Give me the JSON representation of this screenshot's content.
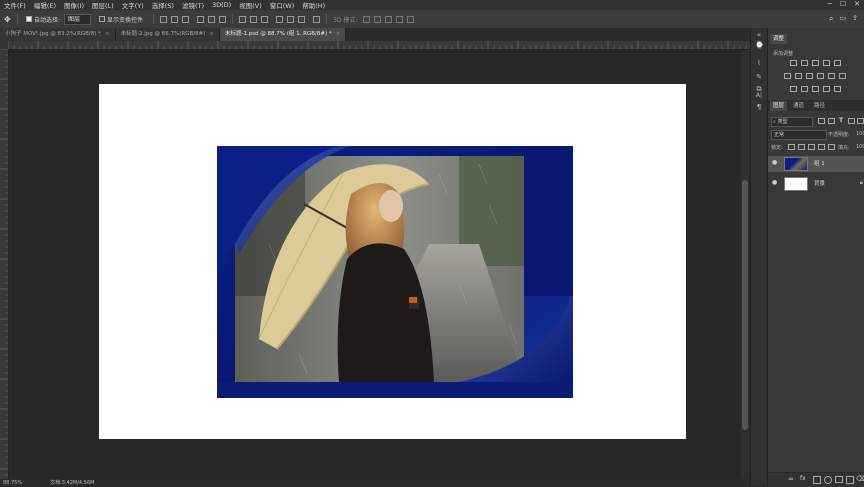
{
  "menu": [
    "文件(F)",
    "编辑(E)",
    "图像(I)",
    "图层(L)",
    "文字(Y)",
    "选择(S)",
    "滤镜(T)",
    "3D(D)",
    "视图(V)",
    "窗口(W)",
    "帮助(H)"
  ],
  "options": {
    "auto_select_label": "自动选择:",
    "auto_select_value": "图层",
    "transform_label": "显示变换控件",
    "mode_3d_label": "3D 模式:"
  },
  "tabs": [
    {
      "label": "小狗子 MOV!.jpg @ 83.2%(RGB/8) *",
      "active": false
    },
    {
      "label": "未标题-2.jpg @ 66.7%(RGB/8#)",
      "active": false
    },
    {
      "label": "未标题-1.psd @ 88.7% (组 1, RGB/8#) *",
      "active": true
    }
  ],
  "status": {
    "zoom": "88.75%",
    "doc": "文档:3.42M/4.56M"
  },
  "panels": {
    "adjust_tab": "调整",
    "add_adjust_label": "添加调整",
    "layers_tab": "图层",
    "channels_tab": "通道",
    "paths_tab": "路径",
    "kind_filter": "类型",
    "blend_mode": "正常",
    "opacity_label": "不透明度:",
    "opacity_value": "100",
    "lock_label": "锁定:",
    "fill_label": "填充:",
    "fill_value": "100",
    "layers": [
      {
        "name": "组 1",
        "selected": true
      },
      {
        "name": "背景",
        "selected": false
      }
    ]
  },
  "colors": {
    "workspace": "#282828",
    "canvas": "#ffffff",
    "frame_blue": "#0a1a80",
    "selected_row": "#545454"
  }
}
